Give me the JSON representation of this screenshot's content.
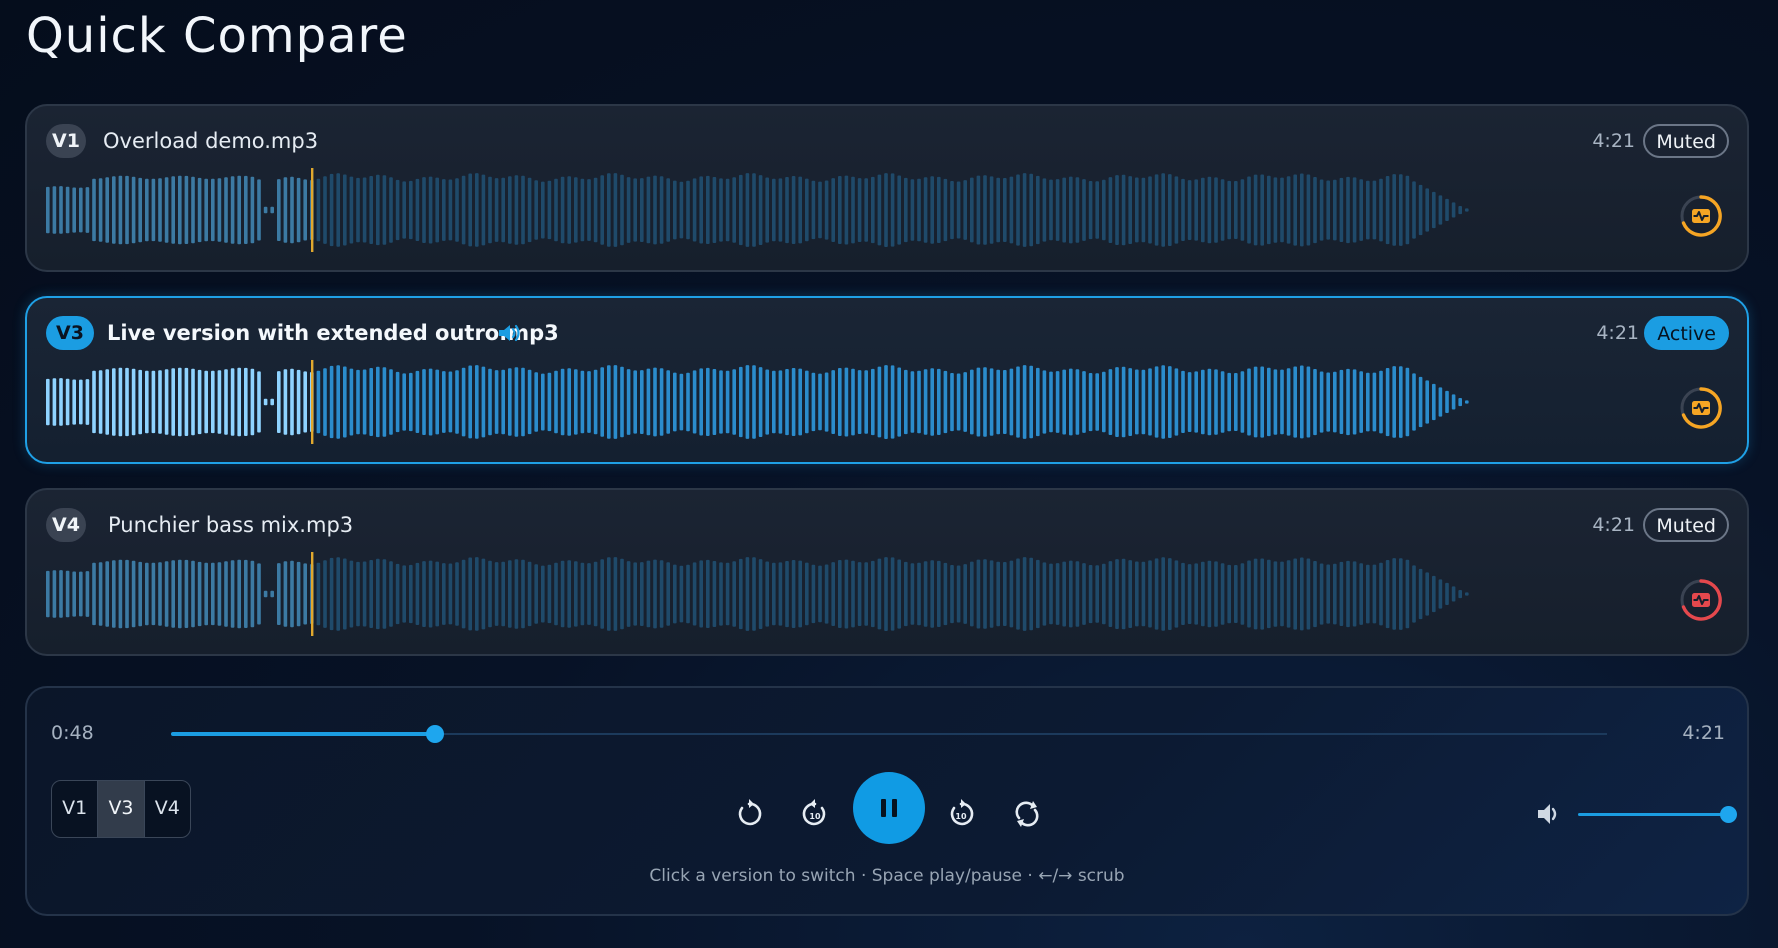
{
  "page": {
    "title": "Quick Compare"
  },
  "tracks": [
    {
      "badge": "V1",
      "filename": "Overload demo.mp3",
      "duration": "4:21",
      "status": "Muted",
      "active": false,
      "ring_color": "#f5a524"
    },
    {
      "badge": "V3",
      "filename": "Live version with extended outro.mp3",
      "duration": "4:21",
      "status": "Active",
      "active": true,
      "ring_color": "#f5a524"
    },
    {
      "badge": "V4",
      "filename": "Punchier bass mix.mp3",
      "duration": "4:21",
      "status": "Muted",
      "active": false,
      "ring_color": "#e5484d"
    }
  ],
  "colors": {
    "accent": "#1b9de2",
    "playhead": "#e0a82e",
    "wave_played_muted": "#3c7aa3",
    "wave_unplayed_muted": "#1f4a6a",
    "wave_played_active": "#8fd3ff",
    "wave_unplayed_active": "#2b8ccc"
  },
  "player": {
    "current_time": "0:48",
    "total_time": "4:21",
    "progress": 0.184,
    "volume": 1.0,
    "version_buttons": [
      "V1",
      "V3",
      "V4"
    ],
    "selected_version": "V3",
    "hint": "Click a version to switch · Space play/pause · ←/→ scrub",
    "icons": [
      "restart-icon",
      "rewind-10-icon",
      "pause-icon",
      "forward-10-icon",
      "loop-icon",
      "volume-icon"
    ]
  }
}
